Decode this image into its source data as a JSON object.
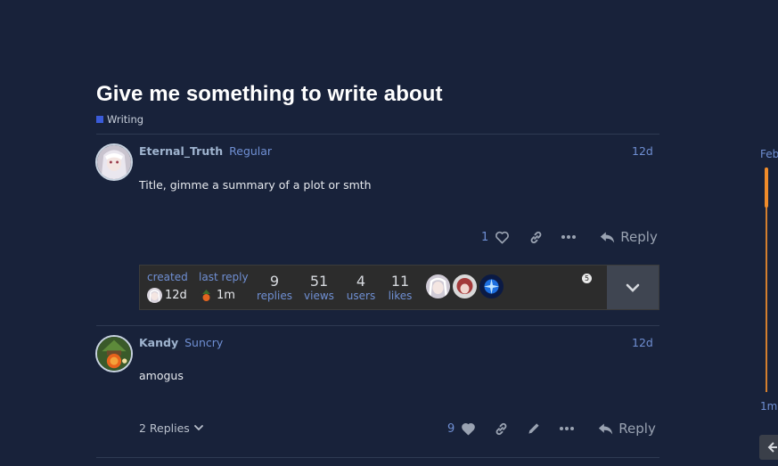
{
  "topic": {
    "title": "Give me something to write about",
    "category": "Writing",
    "category_color": "#3a5bd9"
  },
  "posts": [
    {
      "username": "Eternal_Truth",
      "user_title": "Regular",
      "date": "12d",
      "body": "Title, gimme a summary of a plot or smth",
      "like_count": "1",
      "reply_label": "Reply"
    },
    {
      "username": "Kandy",
      "user_title": "Suncry",
      "date": "12d",
      "body": "amogus",
      "like_count": "9",
      "reply_label": "Reply",
      "replies_toggle": "2 Replies"
    }
  ],
  "topic_map": {
    "created_label": "created",
    "created_time": "12d",
    "last_reply_label": "last reply",
    "last_reply_time": "1m",
    "replies_num": "9",
    "replies_label": "replies",
    "views_num": "51",
    "views_label": "views",
    "users_num": "4",
    "users_label": "users",
    "likes_num": "11",
    "likes_label": "likes",
    "participant_badge": "5"
  },
  "timeline": {
    "start_label": "Feb",
    "end_label": "1m"
  },
  "colors": {
    "background": "#18223a",
    "accent": "#6f8fd3",
    "timeline": "#f08c2a",
    "like_filled": "#9aa3b2"
  }
}
